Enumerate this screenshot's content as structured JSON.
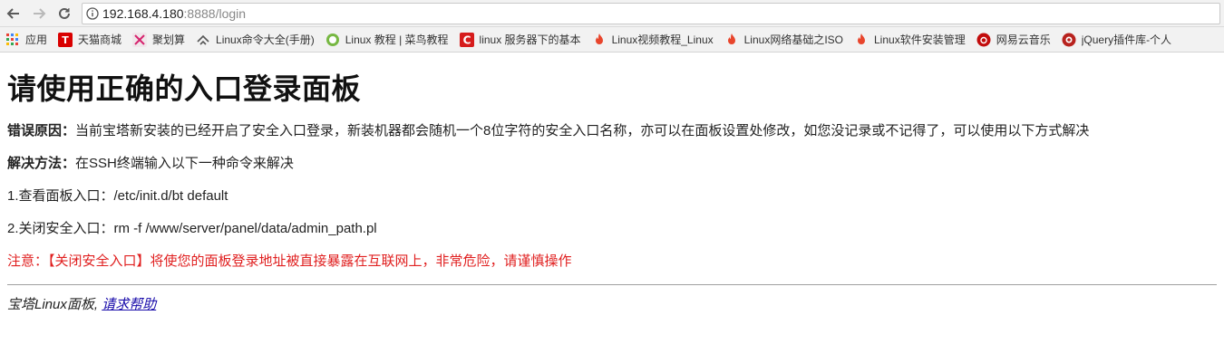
{
  "browser": {
    "url_host": "192.168.4.180",
    "url_rest": ":8888/login"
  },
  "bookmarks": [
    {
      "label": "应用",
      "icon": "apps-grid-icon",
      "color": "#4285f4"
    },
    {
      "label": "天猫商城",
      "icon": "tmall-icon",
      "color": "#d90000"
    },
    {
      "label": "聚划算",
      "icon": "juhuasuan-icon",
      "color": "#d6246e"
    },
    {
      "label": "Linux命令大全(手册)",
      "icon": "linux-command-icon",
      "color": "#555555"
    },
    {
      "label": "Linux 教程 | 菜鸟教程",
      "icon": "runoob-icon",
      "color": "#77b843"
    },
    {
      "label": "linux 服务器下的基本",
      "icon": "csdn-icon",
      "color": "#d61c1c"
    },
    {
      "label": "Linux视频教程_Linux",
      "icon": "flame-icon",
      "color": "#e8452c"
    },
    {
      "label": "Linux网络基础之ISO",
      "icon": "flame-icon",
      "color": "#e8452c"
    },
    {
      "label": "Linux软件安装管理",
      "icon": "flame-icon",
      "color": "#e8452c"
    },
    {
      "label": "网易云音乐",
      "icon": "netease-music-icon",
      "color": "#c20c0c"
    },
    {
      "label": "jQuery插件库-个人",
      "icon": "jquery-icon",
      "color": "#b8221e"
    }
  ],
  "page": {
    "title": "请使用正确的入口登录面板",
    "reason_label": "错误原因：",
    "reason_text": "当前宝塔新安装的已经开启了安全入口登录，新装机器都会随机一个8位字符的安全入口名称，亦可以在面板设置处修改，如您没记录或不记得了，可以使用以下方式解决",
    "solution_label": "解决方法：",
    "solution_text": "在SSH终端输入以下一种命令来解决",
    "step1": "1.查看面板入口：/etc/init.d/bt default",
    "step2": "2.关闭安全入口：rm -f /www/server/panel/data/admin_path.pl",
    "warning": "注意：【关闭安全入口】将使您的面板登录地址被直接暴露在互联网上，非常危险，请谨慎操作",
    "footer_text": "宝塔Linux面板,",
    "footer_link": "请求帮助"
  },
  "colors": {
    "warning": "#e02020",
    "link": "#1a0dab"
  }
}
